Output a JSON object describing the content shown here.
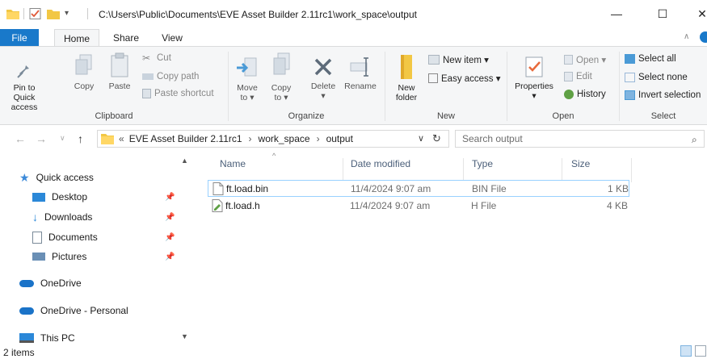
{
  "window": {
    "title": "C:\\Users\\Public\\Documents\\EVE Asset Builder 2.11rc1\\work_space\\output",
    "minimize_glyph": "—",
    "maximize_glyph": "☐",
    "close_glyph": "✕"
  },
  "ribbon": {
    "tabs": [
      {
        "label": "File"
      },
      {
        "label": "Home"
      },
      {
        "label": "Share"
      },
      {
        "label": "View"
      }
    ],
    "clipboard": {
      "pin_label_1": "Pin to Quick",
      "pin_label_2": "access",
      "copy_label": "Copy",
      "paste_label": "Paste",
      "cut_label": "Cut",
      "copy_path_label": "Copy path",
      "paste_shortcut_label": "Paste shortcut",
      "group_label": "Clipboard"
    },
    "organize": {
      "move_label_1": "Move",
      "move_label_2": "to ▾",
      "copyto_label_1": "Copy",
      "copyto_label_2": "to ▾",
      "delete_label_1": "Delete",
      "delete_label_2": "▾",
      "rename_label": "Rename",
      "group_label": "Organize"
    },
    "new": {
      "new_folder_label_1": "New",
      "new_folder_label_2": "folder",
      "new_item_label": "New item ▾",
      "easy_access_label": "Easy access ▾",
      "group_label": "New"
    },
    "open": {
      "properties_label": "Properties",
      "properties_arrow": "▾",
      "open_label": "Open ▾",
      "edit_label": "Edit",
      "history_label": "History",
      "group_label": "Open"
    },
    "select": {
      "select_all_label": "Select all",
      "select_none_label": "Select none",
      "invert_label": "Invert selection",
      "group_label": "Select"
    }
  },
  "address": {
    "overflow": "«",
    "crumbs": [
      {
        "label": "EVE Asset Builder 2.11rc1"
      },
      {
        "label": "work_space"
      },
      {
        "label": "output"
      }
    ],
    "crumb_sep": "›",
    "dropdown": "∨",
    "refresh": "↻",
    "search_placeholder": "Search output"
  },
  "nav": {
    "quick_access": "Quick access",
    "desktop": "Desktop",
    "downloads": "Downloads",
    "documents": "Documents",
    "pictures": "Pictures",
    "onedrive": "OneDrive",
    "onedrive_personal": "OneDrive - Personal",
    "this_pc": "This PC"
  },
  "files": {
    "columns": {
      "name": "Name",
      "date": "Date modified",
      "type": "Type",
      "size": "Size"
    },
    "rows": [
      {
        "name": "ft.load.bin",
        "date": "11/4/2024 9:07 am",
        "type": "BIN File",
        "size": "1 KB"
      },
      {
        "name": "ft.load.h",
        "date": "11/4/2024 9:07 am",
        "type": "H File",
        "size": "4 KB"
      }
    ]
  },
  "status": {
    "count": "2 items"
  },
  "colors": {
    "accent": "#1979ca",
    "folder": "#f2c744",
    "selection_border": "#99d1ff"
  }
}
